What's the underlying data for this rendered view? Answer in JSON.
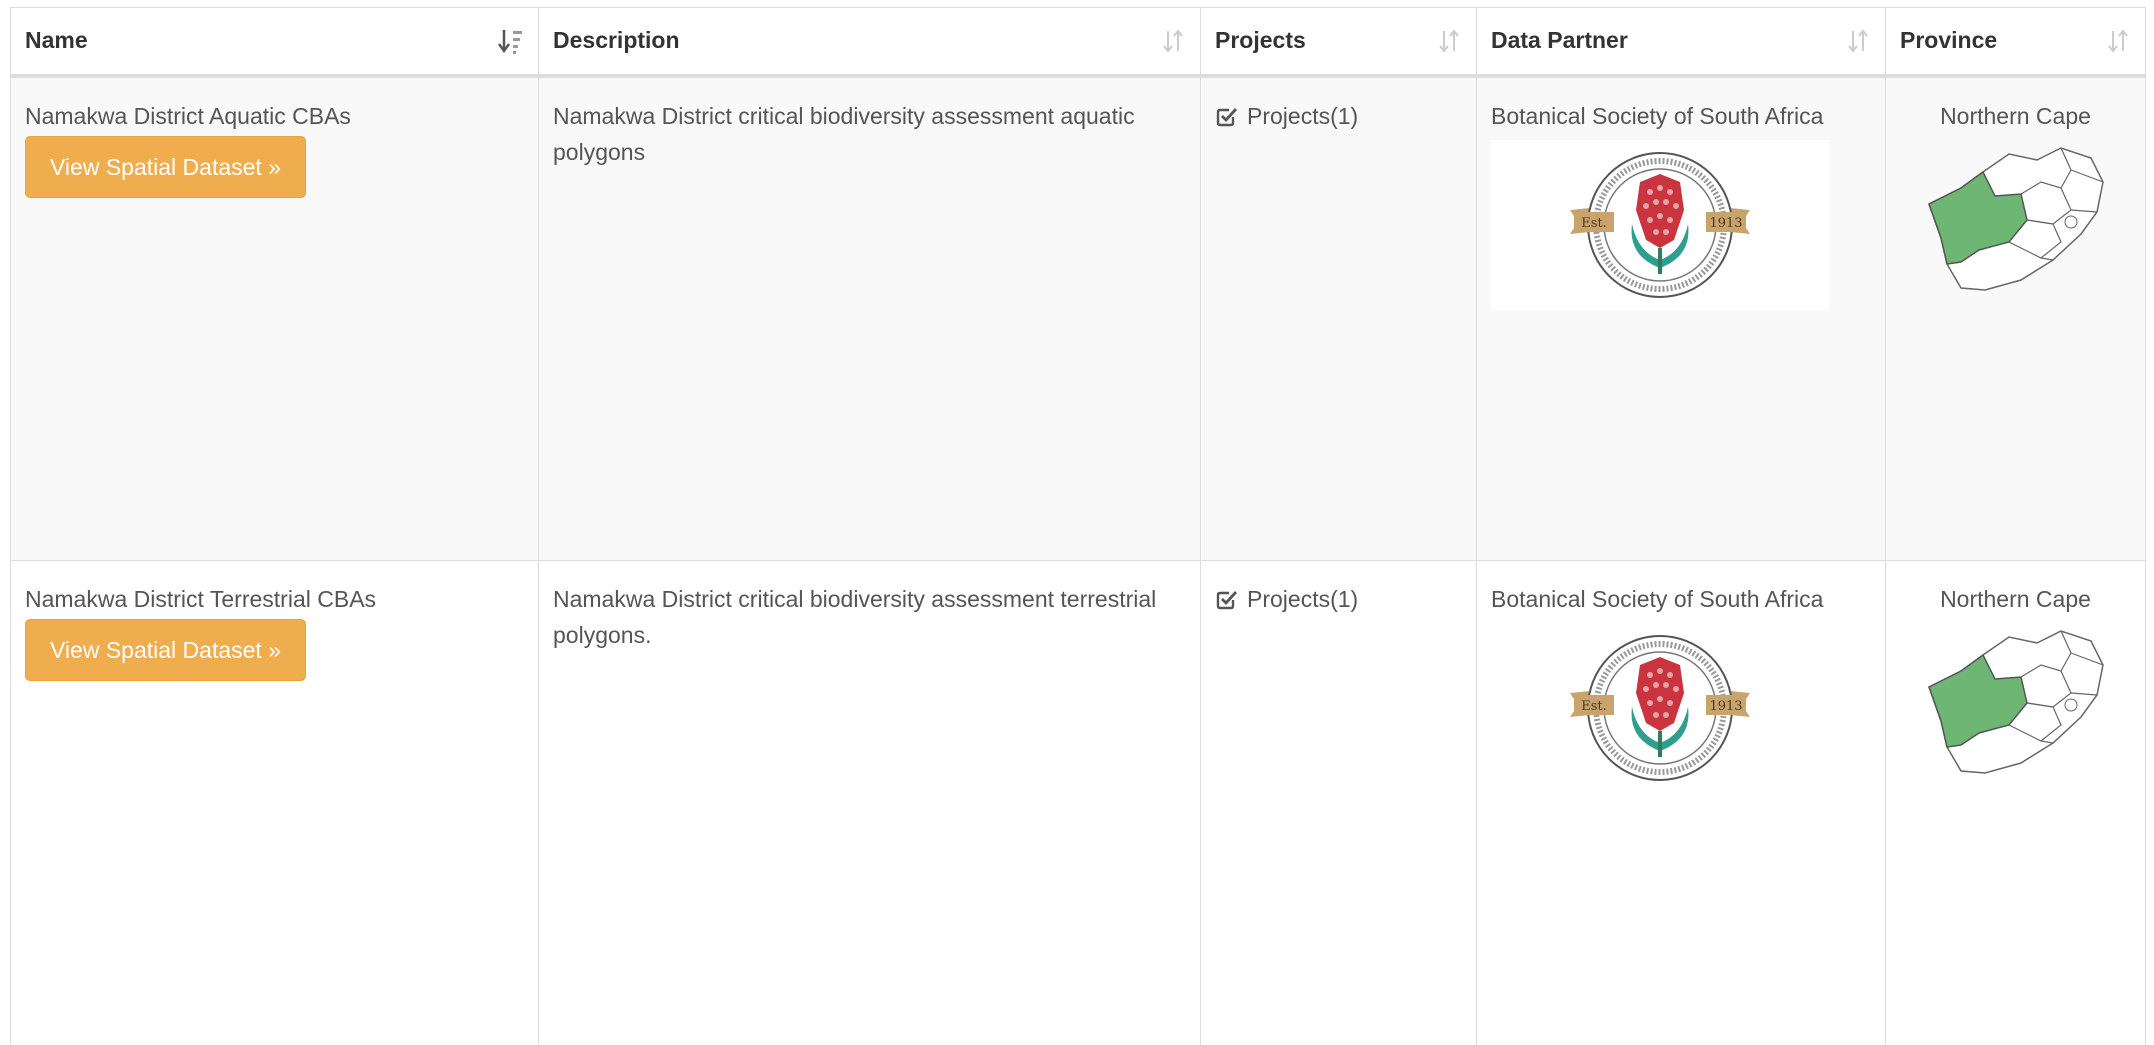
{
  "table": {
    "columns": [
      {
        "key": "name",
        "label": "Name",
        "sort_icon": "sort-alpha-asc-icon"
      },
      {
        "key": "description",
        "label": "Description",
        "sort_icon": "sort-icon"
      },
      {
        "key": "projects",
        "label": "Projects",
        "sort_icon": "sort-icon"
      },
      {
        "key": "partner",
        "label": "Data Partner",
        "sort_icon": "sort-icon"
      },
      {
        "key": "province",
        "label": "Province",
        "sort_icon": "sort-icon"
      }
    ],
    "rows": [
      {
        "name": "Namakwa District Aquatic CBAs",
        "button_label": "View Spatial Dataset »",
        "description": "Namakwa District critical biodiversity assessment aquatic polygons",
        "projects": "Projects(1)",
        "partner": "Botanical Society of South Africa",
        "province": "Northern Cape"
      },
      {
        "name": "Namakwa District Terrestrial CBAs",
        "button_label": "View Spatial Dataset »",
        "description": "Namakwa District critical biodiversity assessment terrestrial polygons.",
        "projects": "Projects(1)",
        "partner": "Botanical Society of South Africa",
        "province": "Northern Cape"
      }
    ]
  },
  "logo": {
    "ribbon_left": "Est.",
    "ribbon_right": "1913"
  },
  "colors": {
    "button": "#f0ad4e",
    "province_highlight": "#6db673",
    "header_border": "#dddddd",
    "row_stripe": "#f9f9f9"
  }
}
